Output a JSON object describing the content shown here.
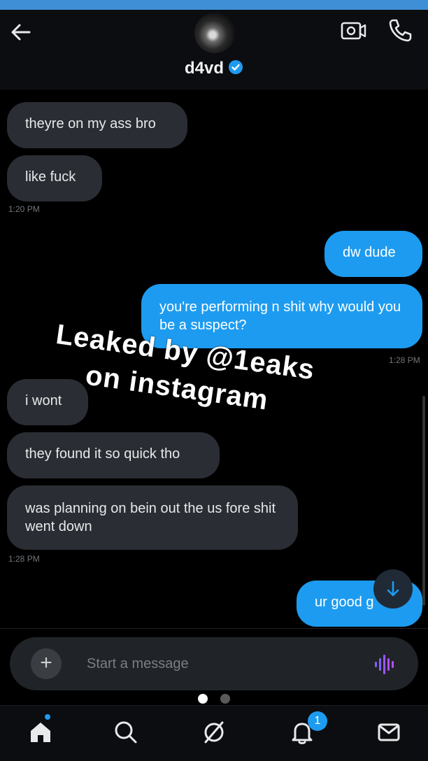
{
  "header": {
    "username": "d4vd",
    "verified": true,
    "icons": [
      "back-arrow-icon",
      "video-call-icon",
      "phone-icon"
    ]
  },
  "messages": [
    {
      "side": "in",
      "text": "theyre on my ass bro"
    },
    {
      "side": "in",
      "text": "like fuck"
    },
    {
      "side": "in",
      "time": "1:20 PM"
    },
    {
      "side": "out",
      "text": "dw dude"
    },
    {
      "side": "out",
      "text": "you're performing n shit why would you be a suspect?"
    },
    {
      "side": "out",
      "time": "1:28 PM"
    },
    {
      "side": "in",
      "text": "i wont"
    },
    {
      "side": "in",
      "text": "they found it so quick tho"
    },
    {
      "side": "in",
      "text": "was planning on bein out the us fore shit went down"
    },
    {
      "side": "in",
      "time": "1:28 PM"
    },
    {
      "side": "out",
      "text": "ur good g"
    }
  ],
  "watermark": {
    "line1": "Leaked by @1eaks",
    "line2": "on instagram"
  },
  "composer": {
    "placeholder": "Start a message"
  },
  "pager": {
    "active_index": 0,
    "count": 2
  },
  "tabbar": {
    "items": [
      "home-icon",
      "search-icon",
      "communities-icon",
      "notifications-icon",
      "messages-icon"
    ],
    "notification_count": "1"
  },
  "colors": {
    "accent": "#1d9bf0",
    "incoming_bubble": "#2a2d33",
    "background": "#000000"
  }
}
